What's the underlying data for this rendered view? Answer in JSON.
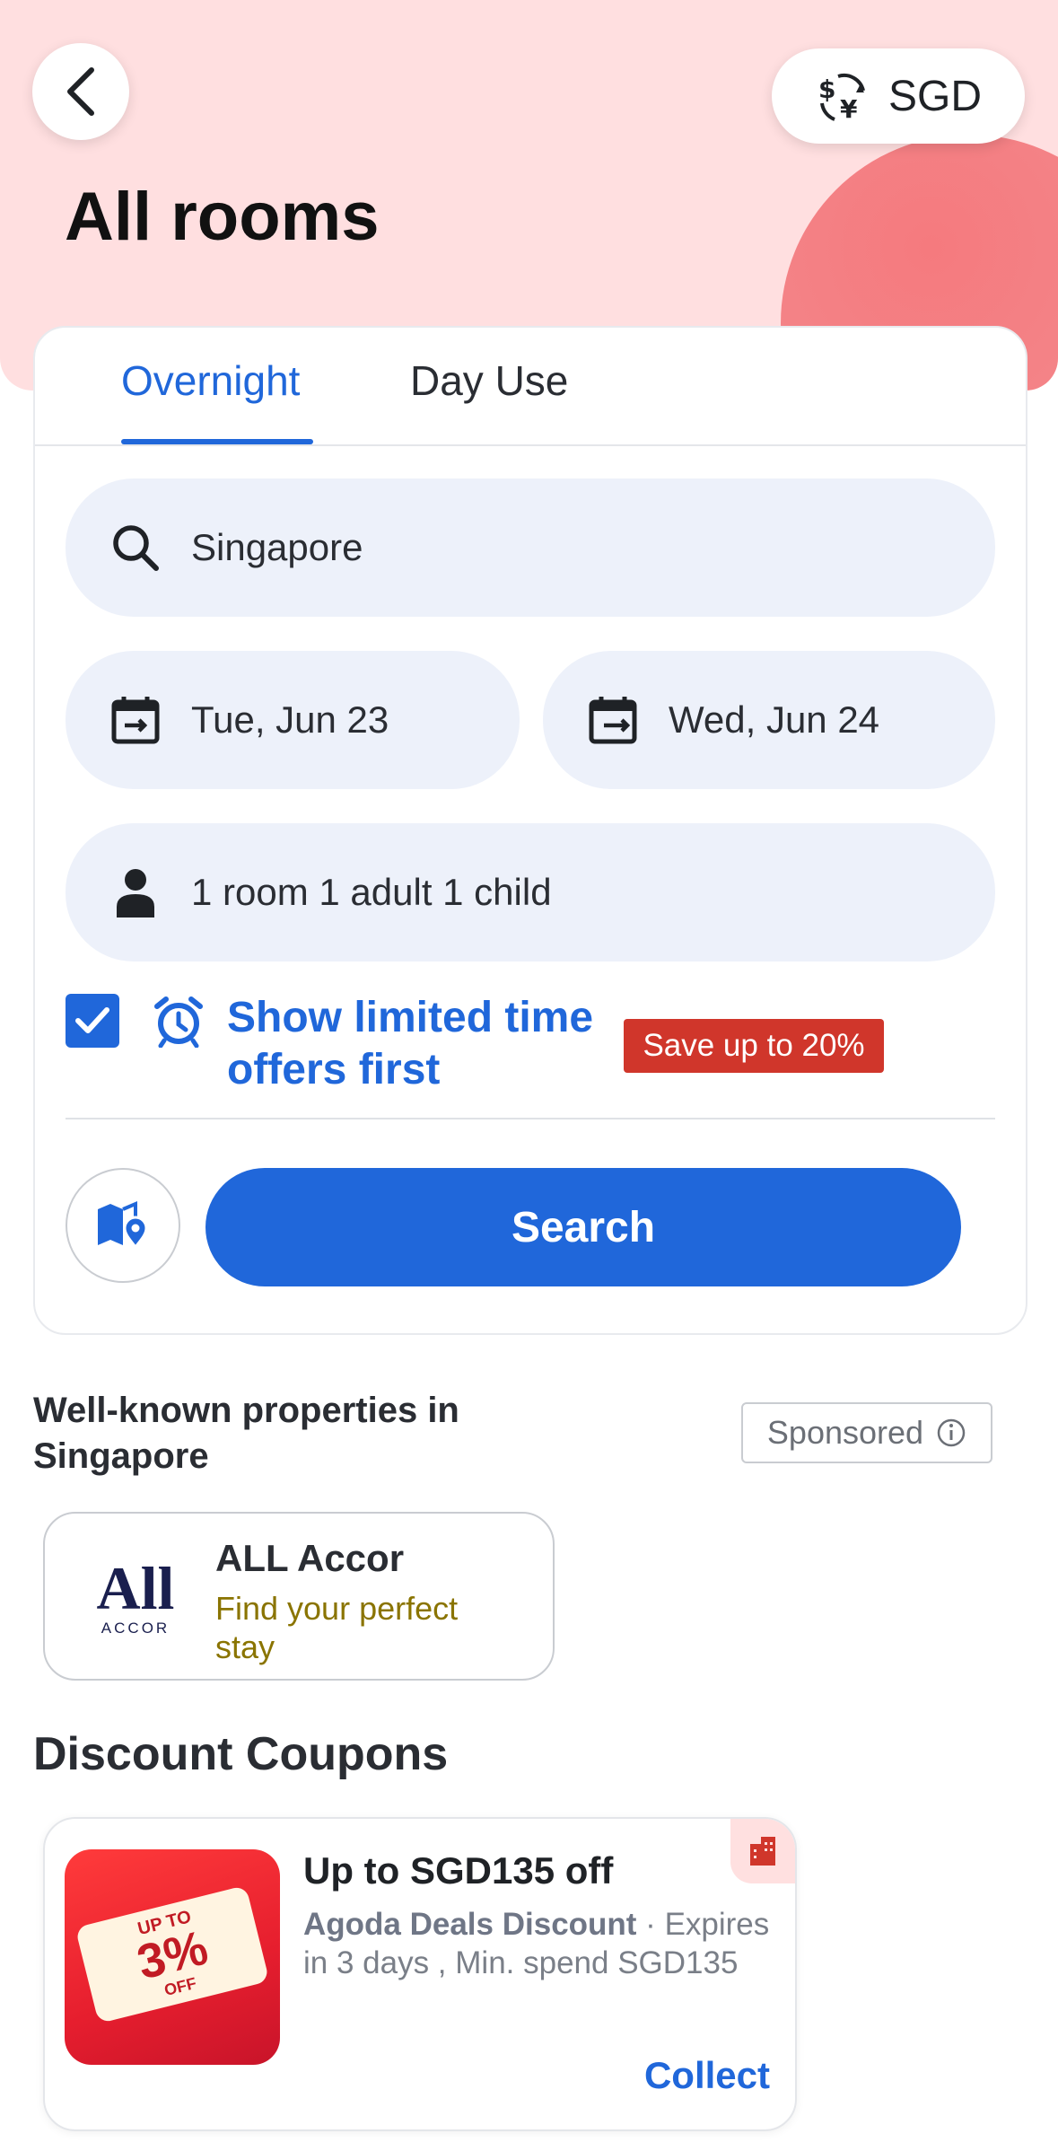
{
  "header": {
    "currency": "SGD",
    "title": "All rooms"
  },
  "tabs": [
    {
      "label": "Overnight",
      "active": true
    },
    {
      "label": "Day Use",
      "active": false
    }
  ],
  "search": {
    "destination": "Singapore",
    "check_in": "Tue, Jun 23",
    "check_out": "Wed, Jun 24",
    "occupancy": "1 room 1 adult 1 child",
    "limited_offer_checked": true,
    "limited_offer_label": "Show limited time offers first",
    "save_badge": "Save up to 20%",
    "search_button": "Search"
  },
  "well_known": {
    "title": "Well-known properties in Singapore",
    "sponsored_label": "Sponsored",
    "card": {
      "logo_text": "All",
      "logo_subtext": "ACCOR",
      "name": "ALL Accor",
      "subtitle": "Find your perfect stay"
    }
  },
  "discount": {
    "title": "Discount Coupons",
    "coupon": {
      "image_upto": "UP TO",
      "image_percent": "3%",
      "image_off": "OFF",
      "title": "Up to SGD135 off",
      "brand": "Agoda Deals Discount",
      "separator": " · ",
      "details": "Expires in 3 days , Min. spend SGD135",
      "collect_label": "Collect"
    }
  },
  "colors": {
    "accent": "#2067da",
    "hero_bg": "#ffdfe0",
    "badge_red": "#d0362b"
  }
}
